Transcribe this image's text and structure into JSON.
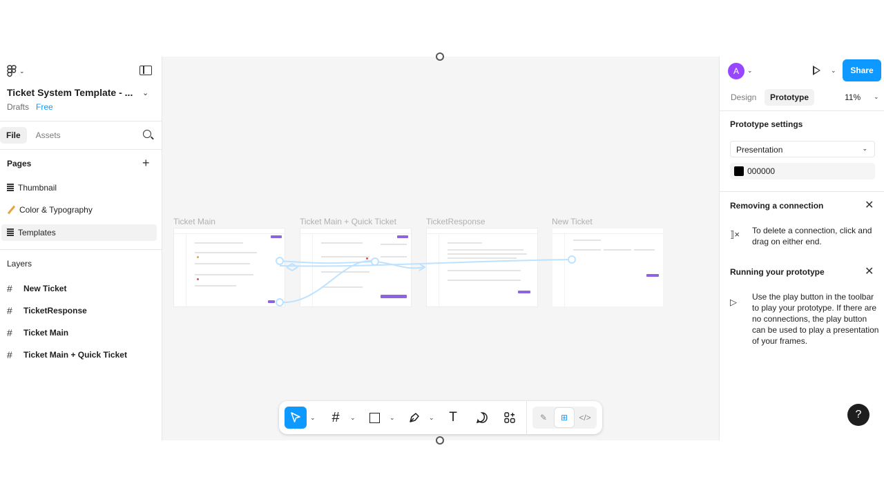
{
  "file": {
    "title": "Ticket System Template - ...",
    "location": "Drafts",
    "plan": "Free"
  },
  "left_tabs": {
    "file": "File",
    "assets": "Assets"
  },
  "pages": {
    "heading": "Pages",
    "items": [
      {
        "label": "Thumbnail",
        "icon": "page-icon"
      },
      {
        "label": "Color & Typography",
        "icon": "pencil-icon"
      },
      {
        "label": "Templates",
        "icon": "page-icon",
        "selected": true
      }
    ]
  },
  "layers": {
    "heading": "Layers",
    "items": [
      "New Ticket",
      "TicketResponse",
      "Ticket Main",
      "Ticket Main + Quick Ticket"
    ]
  },
  "canvas": {
    "frames": [
      "Ticket Main",
      "Ticket Main + Quick Ticket",
      "TicketResponse",
      "New Ticket"
    ],
    "accent": "#8c64e0",
    "connection_color": "#bde2ff"
  },
  "toolbar": {
    "tools": [
      "move-tool",
      "frame-tool",
      "rectangle-tool",
      "pen-tool",
      "text-tool",
      "comment-tool",
      "actions-tool"
    ],
    "active_tool": "move-tool",
    "modes": [
      "draw-mode",
      "design-mode",
      "dev-mode"
    ],
    "active_mode": "design-mode"
  },
  "right": {
    "avatar_letter": "A",
    "share_label": "Share",
    "tabs": {
      "design": "Design",
      "prototype": "Prototype"
    },
    "active_tab": "Prototype",
    "zoom": "11%",
    "prototype_settings": {
      "heading": "Prototype settings",
      "device": "Presentation",
      "background_hex": "000000"
    },
    "removing": {
      "heading": "Removing a connection",
      "text": "To delete a connection, click and drag on either end."
    },
    "running": {
      "heading": "Running your prototype",
      "text": "Use the play button in the toolbar to play your prototype. If there are no connections, the play button can be used to play a presentation of your frames."
    },
    "help": "?"
  },
  "colors": {
    "brand_blue": "#0d99ff",
    "avatar_purple": "#9747ff"
  }
}
